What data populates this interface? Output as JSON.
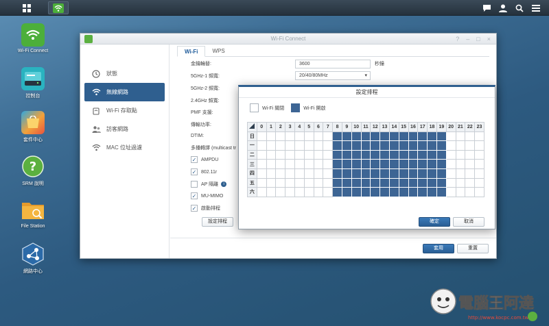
{
  "taskbar": {
    "main_menu_icon": "grid-icon",
    "active_app_icon": "wifi-icon",
    "right_icons": [
      "chat-icon",
      "user-icon",
      "search-icon",
      "options-icon"
    ]
  },
  "desktop": {
    "icons": [
      {
        "label": "Wi-Fi Connect",
        "icon": "wifi-icon",
        "color": "#4caf3a"
      },
      {
        "label": "控制台",
        "icon": "router-icon",
        "color": "#2ab3c0"
      },
      {
        "label": "套件中心",
        "icon": "package-icon",
        "color": "#f2a23a"
      },
      {
        "label": "SRM 說明",
        "icon": "help-icon",
        "color": "#5bb040"
      },
      {
        "label": "File Station",
        "icon": "folder-icon",
        "color": "#f0a830"
      },
      {
        "label": "網路中心",
        "icon": "network-icon",
        "color": "#2b6aa8"
      }
    ]
  },
  "window": {
    "title": "Wi-Fi Connect",
    "controls": [
      "?",
      "–",
      "□",
      "×"
    ],
    "sidebar": [
      {
        "label": "狀態",
        "icon": "status-icon"
      },
      {
        "label": "無線網路",
        "icon": "wifi-icon",
        "active": true
      },
      {
        "label": "Wi-Fi 存取點",
        "icon": "access-point-icon"
      },
      {
        "label": "訪客網路",
        "icon": "guest-icon"
      },
      {
        "label": "MAC 位址過濾",
        "icon": "mac-filter-icon"
      }
    ],
    "tabs": [
      {
        "label": "Wi-Fi",
        "active": true
      },
      {
        "label": "WPS",
        "active": false
      }
    ],
    "form": {
      "group_key_label": "金鑰輪替:",
      "group_key_value": "3600",
      "group_key_unit": "秒鐘",
      "band1_label": "5GHz-1 頻寬:",
      "band1_value": "20/40/80MHz",
      "band2_label": "5GHz-2 頻寬:",
      "band24_label": "2.4GHz 頻寬:",
      "pmf_label": "PMF 支援:",
      "power_label": "傳輸功率:",
      "dtim_label": "DTIM:",
      "multicast_label": "多播轉譯 (multicast tr"
    },
    "checkboxes": [
      {
        "label": "AMPDU",
        "checked": true
      },
      {
        "label": "802.11r",
        "checked": true
      },
      {
        "label": "AP 隔離",
        "checked": false,
        "info": "i"
      },
      {
        "label": "MU-MIMO",
        "checked": true
      },
      {
        "label": "啟動排程",
        "checked": true
      }
    ],
    "schedule_button": "設定排程",
    "apply_button": "套用",
    "reset_button": "重置"
  },
  "dialog": {
    "title": "設定排程",
    "legend_off": "Wi-Fi 關閉",
    "legend_on": "Wi-Fi 開啟",
    "hours": [
      "0",
      "1",
      "2",
      "3",
      "4",
      "5",
      "6",
      "7",
      "8",
      "9",
      "10",
      "11",
      "12",
      "13",
      "14",
      "15",
      "16",
      "17",
      "18",
      "19",
      "20",
      "21",
      "22",
      "23"
    ],
    "days": [
      "日",
      "一",
      "二",
      "三",
      "四",
      "五",
      "六"
    ],
    "on_hours": {
      "start": 8,
      "end": 19
    },
    "on_color": "#3d6594",
    "ok_button": "確定",
    "cancel_button": "取消"
  },
  "watermark": {
    "text": "電腦王阿達",
    "url": "http://www.kocpc.com.tw"
  }
}
